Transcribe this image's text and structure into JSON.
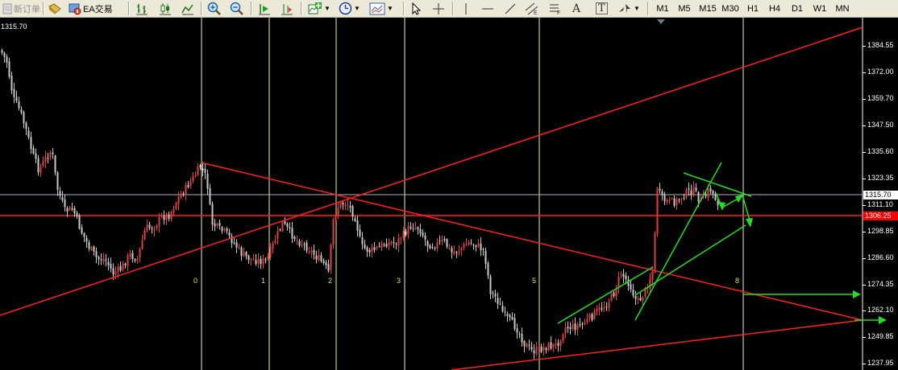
{
  "toolbar": {
    "new_order": "新订单",
    "ea_trading": "EA交易",
    "timeframes": [
      "M1",
      "M5",
      "M15",
      "M30",
      "H1",
      "H4",
      "D1",
      "W1",
      "MN"
    ],
    "icons": [
      "folder-icon",
      "ea-gear-icon",
      "bar-chart-icon",
      "candles-icon",
      "line-chart-icon",
      "zoom-in-icon",
      "zoom-out-icon",
      "autoscroll-icon",
      "chart-shift-icon",
      "indicators-icon",
      "periods-icon",
      "templates-icon",
      "cursor-icon",
      "crosshair-icon",
      "vertical-line-icon",
      "horizontal-line-icon",
      "trendline-icon",
      "equidistant-channel-icon",
      "fibonacci-icon",
      "text-icon",
      "text-label-icon",
      "arrows-icon"
    ],
    "text_tool": "A",
    "label_tool": "T"
  },
  "chart": {
    "top_price": "1315.70",
    "price_axis": [
      "1384.55",
      "1372.00",
      "1359.70",
      "1347.50",
      "1335.60",
      "1323.35",
      "1311.10",
      "1298.85",
      "1286.60",
      "1274.35",
      "1262.10",
      "1249.85",
      "1237.95"
    ],
    "current_bid": "1315.70",
    "level_tag": "1306.25",
    "fib_labels": [
      "0",
      "1",
      "2",
      "3",
      "5",
      "8"
    ],
    "colors": {
      "background": "#000000",
      "candle_up": "#e04040",
      "candle_down": "#c8c8c8",
      "trend_red": "#ff2020",
      "trend_green": "#20e020",
      "fib_vertical": "#f0f0a0",
      "bid_line": "#b0b0c0",
      "level_tag_bg": "#ff0000"
    }
  }
}
